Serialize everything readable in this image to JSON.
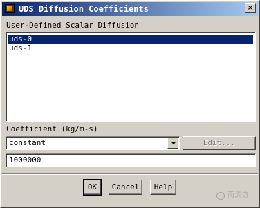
{
  "window": {
    "title": "UDS Diffusion Coefficients",
    "close_symbol": "×",
    "app_icon": "fluent-app-icon",
    "close_icon": "close-icon"
  },
  "scalar_section": {
    "label": "User-Defined Scalar Diffusion",
    "items": [
      "uds-0",
      "uds-1"
    ],
    "selected_index": 0
  },
  "coefficient_section": {
    "label": "Coefficient (kg/m-s)",
    "method_selected": "constant",
    "edit_button_label": "Edit...",
    "value": "1000000"
  },
  "buttons": {
    "ok_label": "OK",
    "cancel_label": "Cancel",
    "help_label": "Help"
  },
  "watermark": {
    "text": "南流坊",
    "icon": "wechat-icon"
  },
  "colors": {
    "titlebar_start": "#0a246a",
    "titlebar_end": "#a6caf0",
    "selection": "#0a246a",
    "face": "#d4d0c8"
  }
}
